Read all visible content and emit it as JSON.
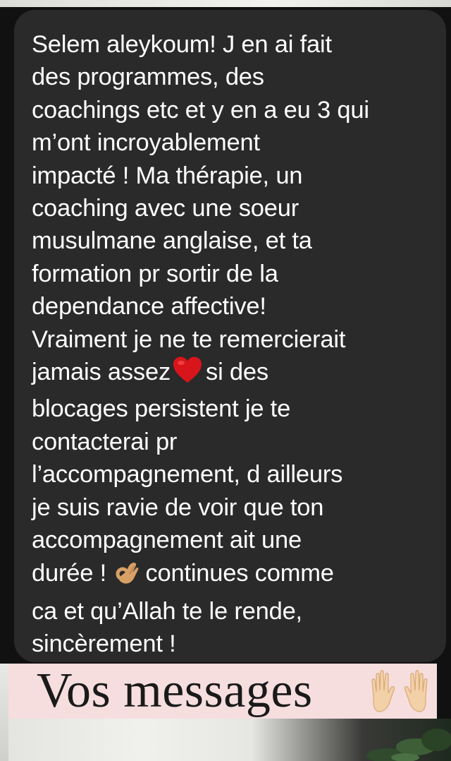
{
  "message": {
    "lines": [
      "Selem aleykoum! J en ai fait",
      "des programmes, des",
      "coachings etc et y en a eu 3 qui",
      "m’ont incroyablement",
      "impacté ! Ma thérapie, un",
      "coaching avec une soeur",
      "musulmane anglaise, et ta",
      "formation pr sortir de la",
      "dependance affective!",
      "Vraiment je ne te remercierait",
      "jamais assez",
      "si des",
      "blocages persistent je te",
      "contacterai pr",
      "l’accompagnement, d ailleurs",
      "je suis ravie de voir que ton",
      "accompagnement ait une",
      "durée !",
      "continues comme",
      "ca et qu’Allah te le rende,",
      "sincèrement !"
    ],
    "emoji": {
      "heart": "red-heart",
      "ok_hand": "ok-hand"
    }
  },
  "banner": {
    "title": "Vos messages",
    "emoji": "raising-hands",
    "background": "#f6dede"
  },
  "colors": {
    "bubble": "#2a2a2a",
    "text": "#ffffff"
  }
}
